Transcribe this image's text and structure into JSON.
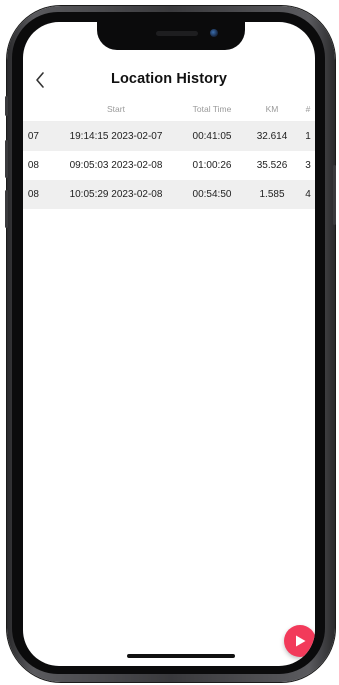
{
  "header": {
    "title": "Location History",
    "back_icon": "chevron-left-icon"
  },
  "table": {
    "columns": {
      "start": "Start",
      "total_time": "Total Time",
      "km": "KM",
      "number": "#"
    },
    "rows": [
      {
        "prev": "07",
        "start": "19:14:15 2023-02-07",
        "total_time": "00:41:05",
        "km": "32.614",
        "number": "1",
        "shaded": true
      },
      {
        "prev": "08",
        "start": "09:05:03 2023-02-08",
        "total_time": "01:00:26",
        "km": "35.526",
        "number": "3",
        "shaded": false
      },
      {
        "prev": "08",
        "start": "10:05:29 2023-02-08",
        "total_time": "00:54:50",
        "km": "1.585",
        "number": "4",
        "shaded": true
      }
    ]
  },
  "fab": {
    "icon": "play-icon",
    "color": "#f23a5a"
  }
}
